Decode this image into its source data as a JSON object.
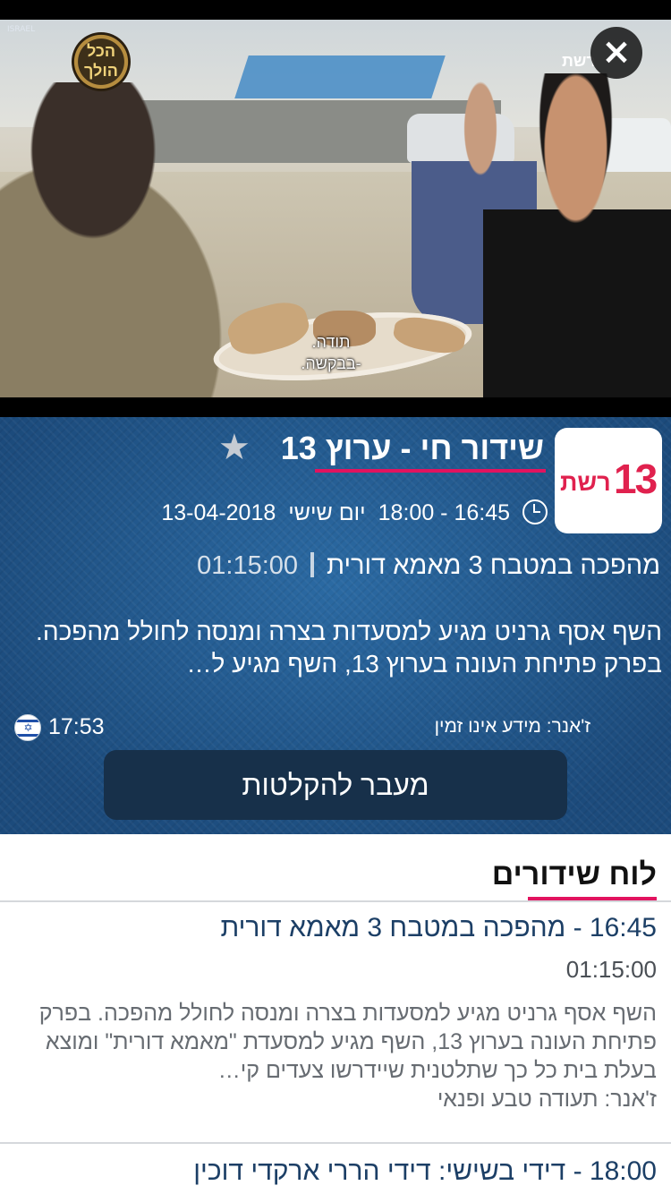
{
  "video": {
    "channel_logo_text": "הכל הולך",
    "network_tag": "ISRAEL",
    "corner_tag": "רשת",
    "subtitle_line1": "תודה.",
    "subtitle_line2": "-בבקשה.",
    "close_icon": "close-icon"
  },
  "live": {
    "channel_number": "13",
    "channel_name": "רשת",
    "title": "שידור חי - ערוץ 13",
    "favorite_icon": "star-icon",
    "clock_icon": "clock-icon",
    "time_range": "16:45 - 18:00",
    "day": "יום שישי",
    "date": "13-04-2018",
    "program_title": "מהפכה במטבח 3 מאמא דורית",
    "program_duration": "01:15:00",
    "description": "השף אסף גרניט מגיע למסעדות בצרה ומנסה לחולל מהפכה. בפרק פתיחת העונה בערוץ 13, השף מגיע ל…",
    "genre": "ז'אנר: מידע אינו זמין",
    "current_time": "17:53",
    "flag_icon": "israel-flag-icon",
    "go_button": "מעבר להקלטות"
  },
  "schedule": {
    "heading": "לוח שידורים",
    "items": [
      {
        "time": "16:45",
        "title": "מהפכה במטבח 3 מאמא דורית",
        "duration": "01:15:00",
        "description": "השף אסף גרניט מגיע למסעדות בצרה ומנסה לחולל מהפכה. בפרק פתיחת העונה בערוץ 13, השף מגיע למסעדת \"מאמא דורית\" ומוצא בעלת בית כל כך שתלטנית שיידרשו צעדים קי…",
        "genre": "ז'אנר: תעודה טבע ופנאי"
      },
      {
        "time": "18:00",
        "title": "דידי בשישי: דידי הררי ארקדי דוכין"
      }
    ]
  },
  "colors": {
    "accent_pink": "#e2135f",
    "panel_blue": "#1f5385",
    "button_dark": "#17304a"
  }
}
